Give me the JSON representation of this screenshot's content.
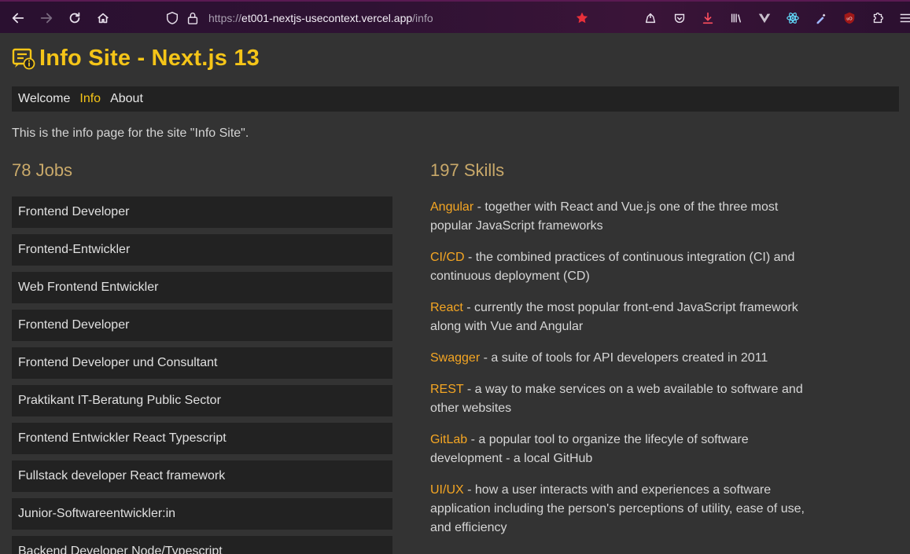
{
  "browser": {
    "url_scheme": "https://",
    "url_host": "et001-nextjs-usecontext.vercel.app",
    "url_path": "/info",
    "accent_star": "#e8303a"
  },
  "site": {
    "title": "Info Site - Next.js 13",
    "logo_icon": "message-info-icon"
  },
  "nav": {
    "items": [
      {
        "label": "Welcome",
        "active": false
      },
      {
        "label": "Info",
        "active": true
      },
      {
        "label": "About",
        "active": false
      }
    ]
  },
  "intro": "This is the info page for the site \"Info Site\".",
  "jobs": {
    "heading": "78 Jobs",
    "items": [
      "Frontend Developer",
      "Frontend-Entwickler",
      "Web Frontend Entwickler",
      "Frontend Developer",
      "Frontend Developer und Consultant",
      "Praktikant IT-Beratung Public Sector",
      "Frontend Entwickler React Typescript",
      "Fullstack developer React framework",
      "Junior-Softwareentwickler:in",
      "Backend Developer Node/Typescript"
    ]
  },
  "skills": {
    "heading": "197 Skills",
    "items": [
      {
        "name": "Angular",
        "desc": " - together with React and Vue.js one of the three most popular JavaScript frameworks"
      },
      {
        "name": "CI/CD",
        "desc": " - the combined practices of continuous integration (CI) and continuous deployment (CD)"
      },
      {
        "name": "React",
        "desc": " - currently the most popular front-end JavaScript framework along with Vue and Angular"
      },
      {
        "name": "Swagger",
        "desc": " - a suite of tools for API developers created in 2011"
      },
      {
        "name": "REST",
        "desc": " - a way to make services on a web available to software and other websites"
      },
      {
        "name": "GitLab",
        "desc": " - a popular tool to organize the lifecyle of software development - a local GitHub"
      },
      {
        "name": "UI/UX",
        "desc": " - how a user interacts with and experiences a software application including the person's perceptions of utility, ease of use, and efficiency"
      }
    ]
  },
  "colors": {
    "title": "#f5c518",
    "skill_name": "#f5a623",
    "heading": "#c9a96a",
    "background": "#333333",
    "panel": "#222222"
  }
}
